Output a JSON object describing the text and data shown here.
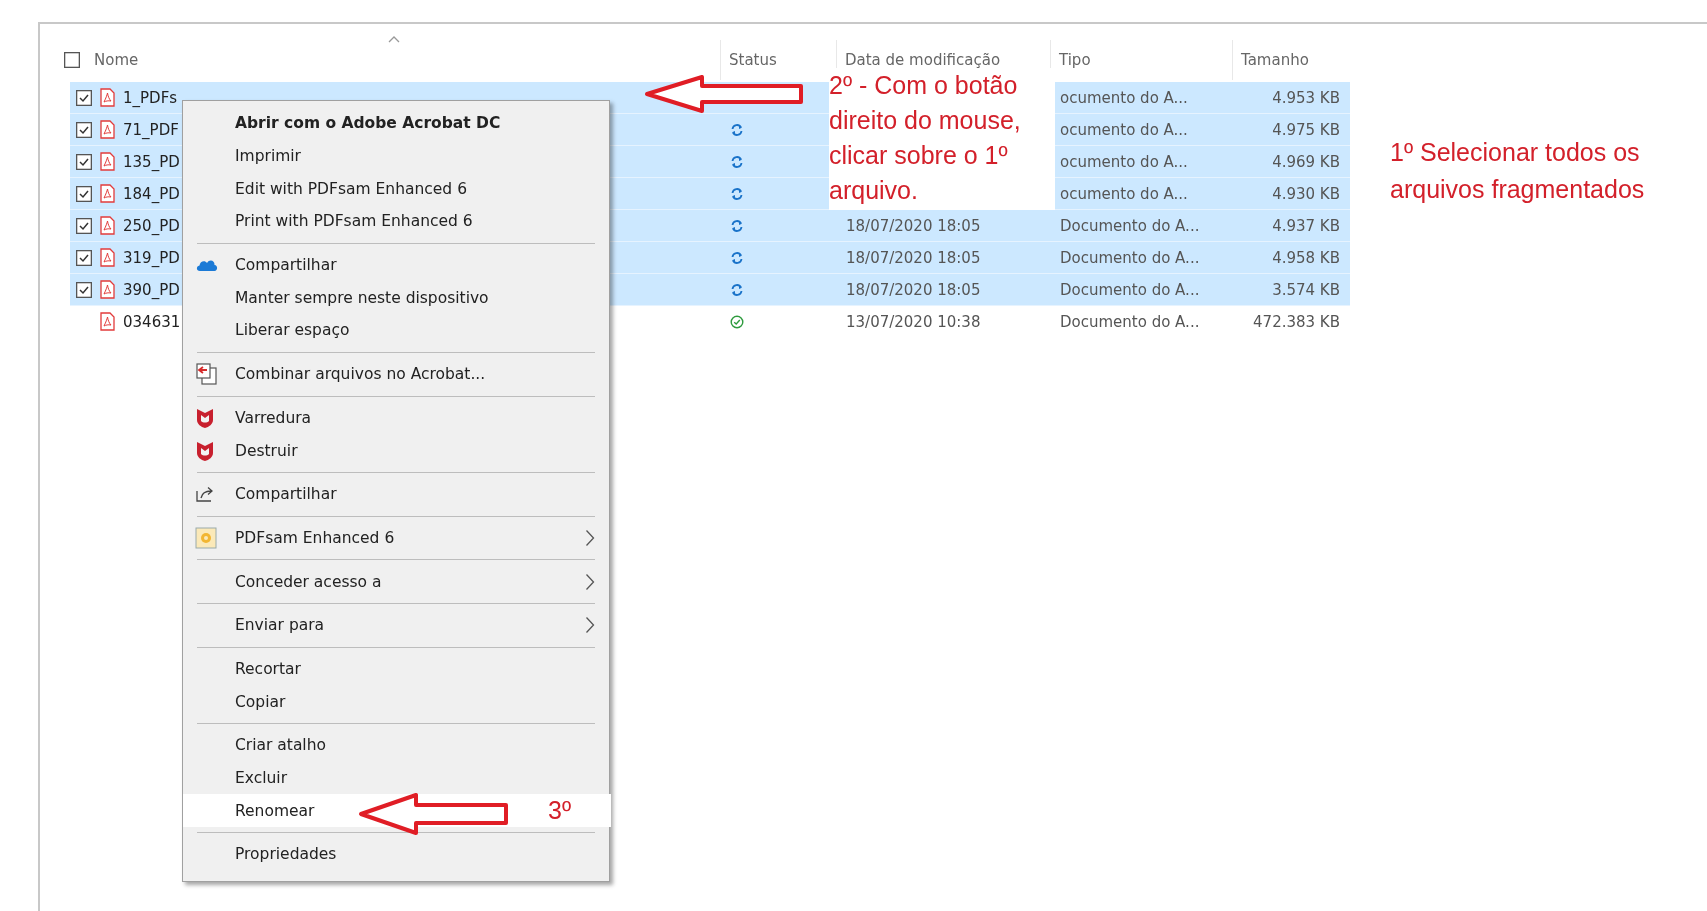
{
  "file_list": {
    "header": {
      "checked": false,
      "columns": [
        "Nome",
        "Status",
        "Data de modificação",
        "Tipo",
        "Tamanho"
      ]
    },
    "rows": [
      {
        "name": "1_PDFs",
        "selected": true,
        "type": "ocumento do A...",
        "size": "4.953 KB"
      },
      {
        "name": "71_PDF",
        "selected": true,
        "synced": false,
        "type": "ocumento do A...",
        "size": "4.975 KB"
      },
      {
        "name": "135_PD",
        "selected": true,
        "synced": false,
        "type": "ocumento do A...",
        "size": "4.969 KB"
      },
      {
        "name": "184_PD",
        "selected": true,
        "synced": false,
        "type": "ocumento do A...",
        "size": "4.930 KB"
      },
      {
        "name": "250_PD",
        "selected": true,
        "synced": false,
        "date": "18/07/2020 18:05",
        "type": "Documento do A...",
        "size": "4.937 KB"
      },
      {
        "name": "319_PD",
        "selected": true,
        "synced": false,
        "date": "18/07/2020 18:05",
        "type": "Documento do A...",
        "size": "4.958 KB"
      },
      {
        "name": "390_PD",
        "selected": true,
        "synced": false,
        "date": "18/07/2020 18:05",
        "type": "Documento do A...",
        "size": "3.574 KB"
      },
      {
        "name": "034631",
        "selected": false,
        "synced": true,
        "date": "13/07/2020 10:38",
        "type": "Documento do A...",
        "size": "472.383 KB"
      }
    ]
  },
  "context_menu": {
    "groups": [
      {
        "items": [
          {
            "label": "Abrir com o Adobe Acrobat DC",
            "kind": "plain",
            "default": true
          },
          {
            "label": "Imprimir",
            "kind": "plain"
          },
          {
            "label": "Edit with PDFsam Enhanced 6",
            "kind": "plain"
          },
          {
            "label": "Print with PDFsam Enhanced 6",
            "kind": "plain"
          }
        ]
      },
      {
        "items": [
          {
            "label": "Compartilhar",
            "kind": "cloud"
          },
          {
            "label": "Manter sempre neste dispositivo",
            "kind": "plain"
          },
          {
            "label": "Liberar espaço",
            "kind": "plain"
          }
        ]
      },
      {
        "items": [
          {
            "label": "Combinar arquivos no Acrobat...",
            "kind": "combine"
          }
        ]
      },
      {
        "items": [
          {
            "label": "Varredura",
            "kind": "shield"
          },
          {
            "label": "Destruir",
            "kind": "shield"
          }
        ]
      },
      {
        "items": [
          {
            "label": "Compartilhar",
            "kind": "share"
          }
        ]
      },
      {
        "items": [
          {
            "label": "PDFsam Enhanced 6",
            "kind": "app",
            "submenu": true
          }
        ]
      },
      {
        "items": [
          {
            "label": "Conceder acesso a",
            "kind": "plain",
            "submenu": true
          }
        ]
      },
      {
        "items": [
          {
            "label": "Enviar para",
            "kind": "plain",
            "submenu": true
          }
        ]
      },
      {
        "items": [
          {
            "label": "Recortar",
            "kind": "plain"
          },
          {
            "label": "Copiar",
            "kind": "plain"
          }
        ]
      },
      {
        "items": [
          {
            "label": "Criar atalho",
            "kind": "plain"
          },
          {
            "label": "Excluir",
            "kind": "plain"
          },
          {
            "label": "Renomear",
            "kind": "plain",
            "highlighted": true
          }
        ]
      },
      {
        "items": [
          {
            "label": "Propriedades",
            "kind": "plain"
          }
        ]
      }
    ]
  },
  "annotations": {
    "step_1": "1º Selecionar todos os\narquivos fragmentados",
    "step_2": "2º - Com o botão\ndireito do mouse,\nclicar sobre o 1º\narquivo.",
    "step_3": "3º"
  }
}
